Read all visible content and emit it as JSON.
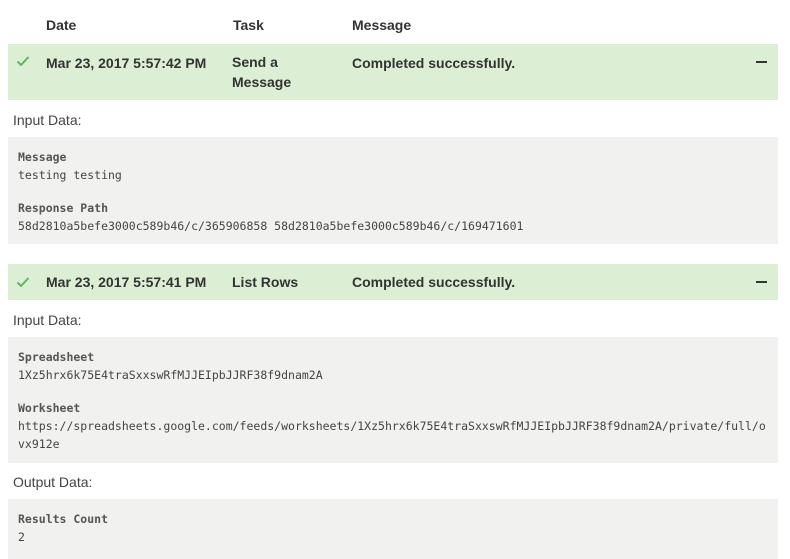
{
  "columns": {
    "date": "Date",
    "task": "Task",
    "message": "Message"
  },
  "entries": [
    {
      "date": "Mar 23, 2017 5:57:42 PM",
      "task_line1": "Send a",
      "task_line2": "Message",
      "message": "Completed successfully.",
      "input_label": "Input Data:",
      "input_fields": [
        {
          "key": "Message",
          "value": "testing testing"
        },
        {
          "key": "Response Path",
          "value": "58d2810a5befe3000c589b46/c/365906858 58d2810a5befe3000c589b46/c/169471601"
        }
      ]
    },
    {
      "date": "Mar 23, 2017 5:57:41 PM",
      "task": "List Rows",
      "message": "Completed successfully.",
      "input_label": "Input Data:",
      "input_fields": [
        {
          "key": "Spreadsheet",
          "value": "1Xz5hrx6k75E4traSxxswRfMJJEIpbJJRF38f9dnam2A"
        },
        {
          "key": "Worksheet",
          "value": "https://spreadsheets.google.com/feeds/worksheets/1Xz5hrx6k75E4traSxxswRfMJJEIpbJJRF38f9dnam2A/private/full/ovx912e"
        }
      ],
      "output_label": "Output Data:",
      "output_fields": [
        {
          "key": "Results Count",
          "value": "2"
        }
      ]
    }
  ],
  "colors": {
    "success_bg": "#dcefd4",
    "check": "#5cb85c",
    "data_bg": "#f1f2ef"
  },
  "icons": {
    "status": "check-icon",
    "toggle": "collapse-minus-icon"
  }
}
